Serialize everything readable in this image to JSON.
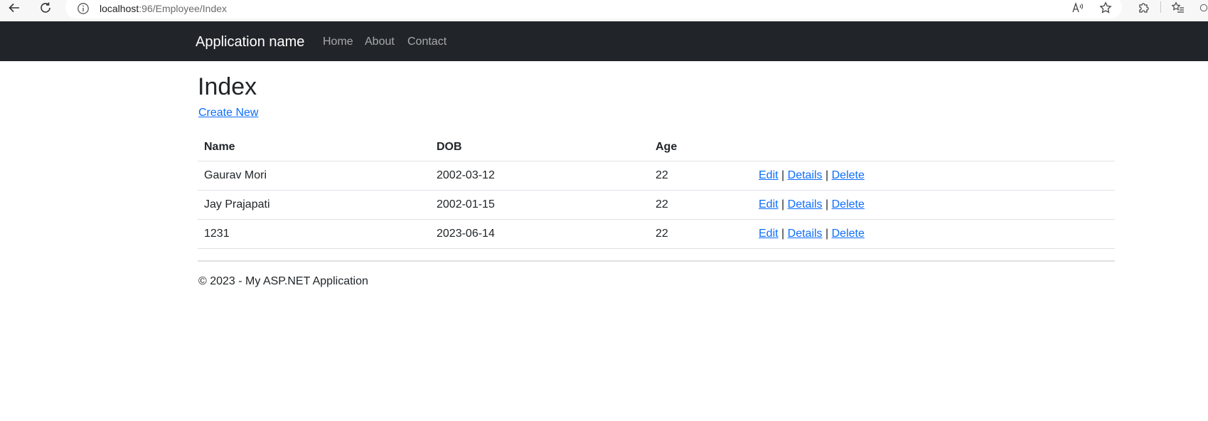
{
  "browser": {
    "url_host": "localhost",
    "url_path": ":96/Employee/Index",
    "icons": [
      "back-arrow-icon",
      "reload-icon",
      "site-info-icon",
      "read-aloud-icon",
      "favorite-star-icon",
      "extensions-icon",
      "favorites-list-icon"
    ]
  },
  "navbar": {
    "brand": "Application name",
    "links": [
      "Home",
      "About",
      "Contact"
    ],
    "bg_color": "#212529"
  },
  "page": {
    "title": "Index",
    "create_link": "Create New"
  },
  "table": {
    "headers": [
      "Name",
      "DOB",
      "Age",
      ""
    ],
    "rows": [
      {
        "name": "Gaurav Mori",
        "dob": "2002-03-12",
        "age": "22"
      },
      {
        "name": "Jay Prajapati",
        "dob": "2002-01-15",
        "age": "22"
      },
      {
        "name": "1231",
        "dob": "2023-06-14",
        "age": "22"
      }
    ],
    "actions": {
      "edit": "Edit",
      "details": "Details",
      "delete": "Delete",
      "separator": "|"
    }
  },
  "footer": {
    "text": "© 2023 - My ASP.NET Application"
  },
  "colors": {
    "link": "#0d6efd",
    "text": "#212529"
  }
}
